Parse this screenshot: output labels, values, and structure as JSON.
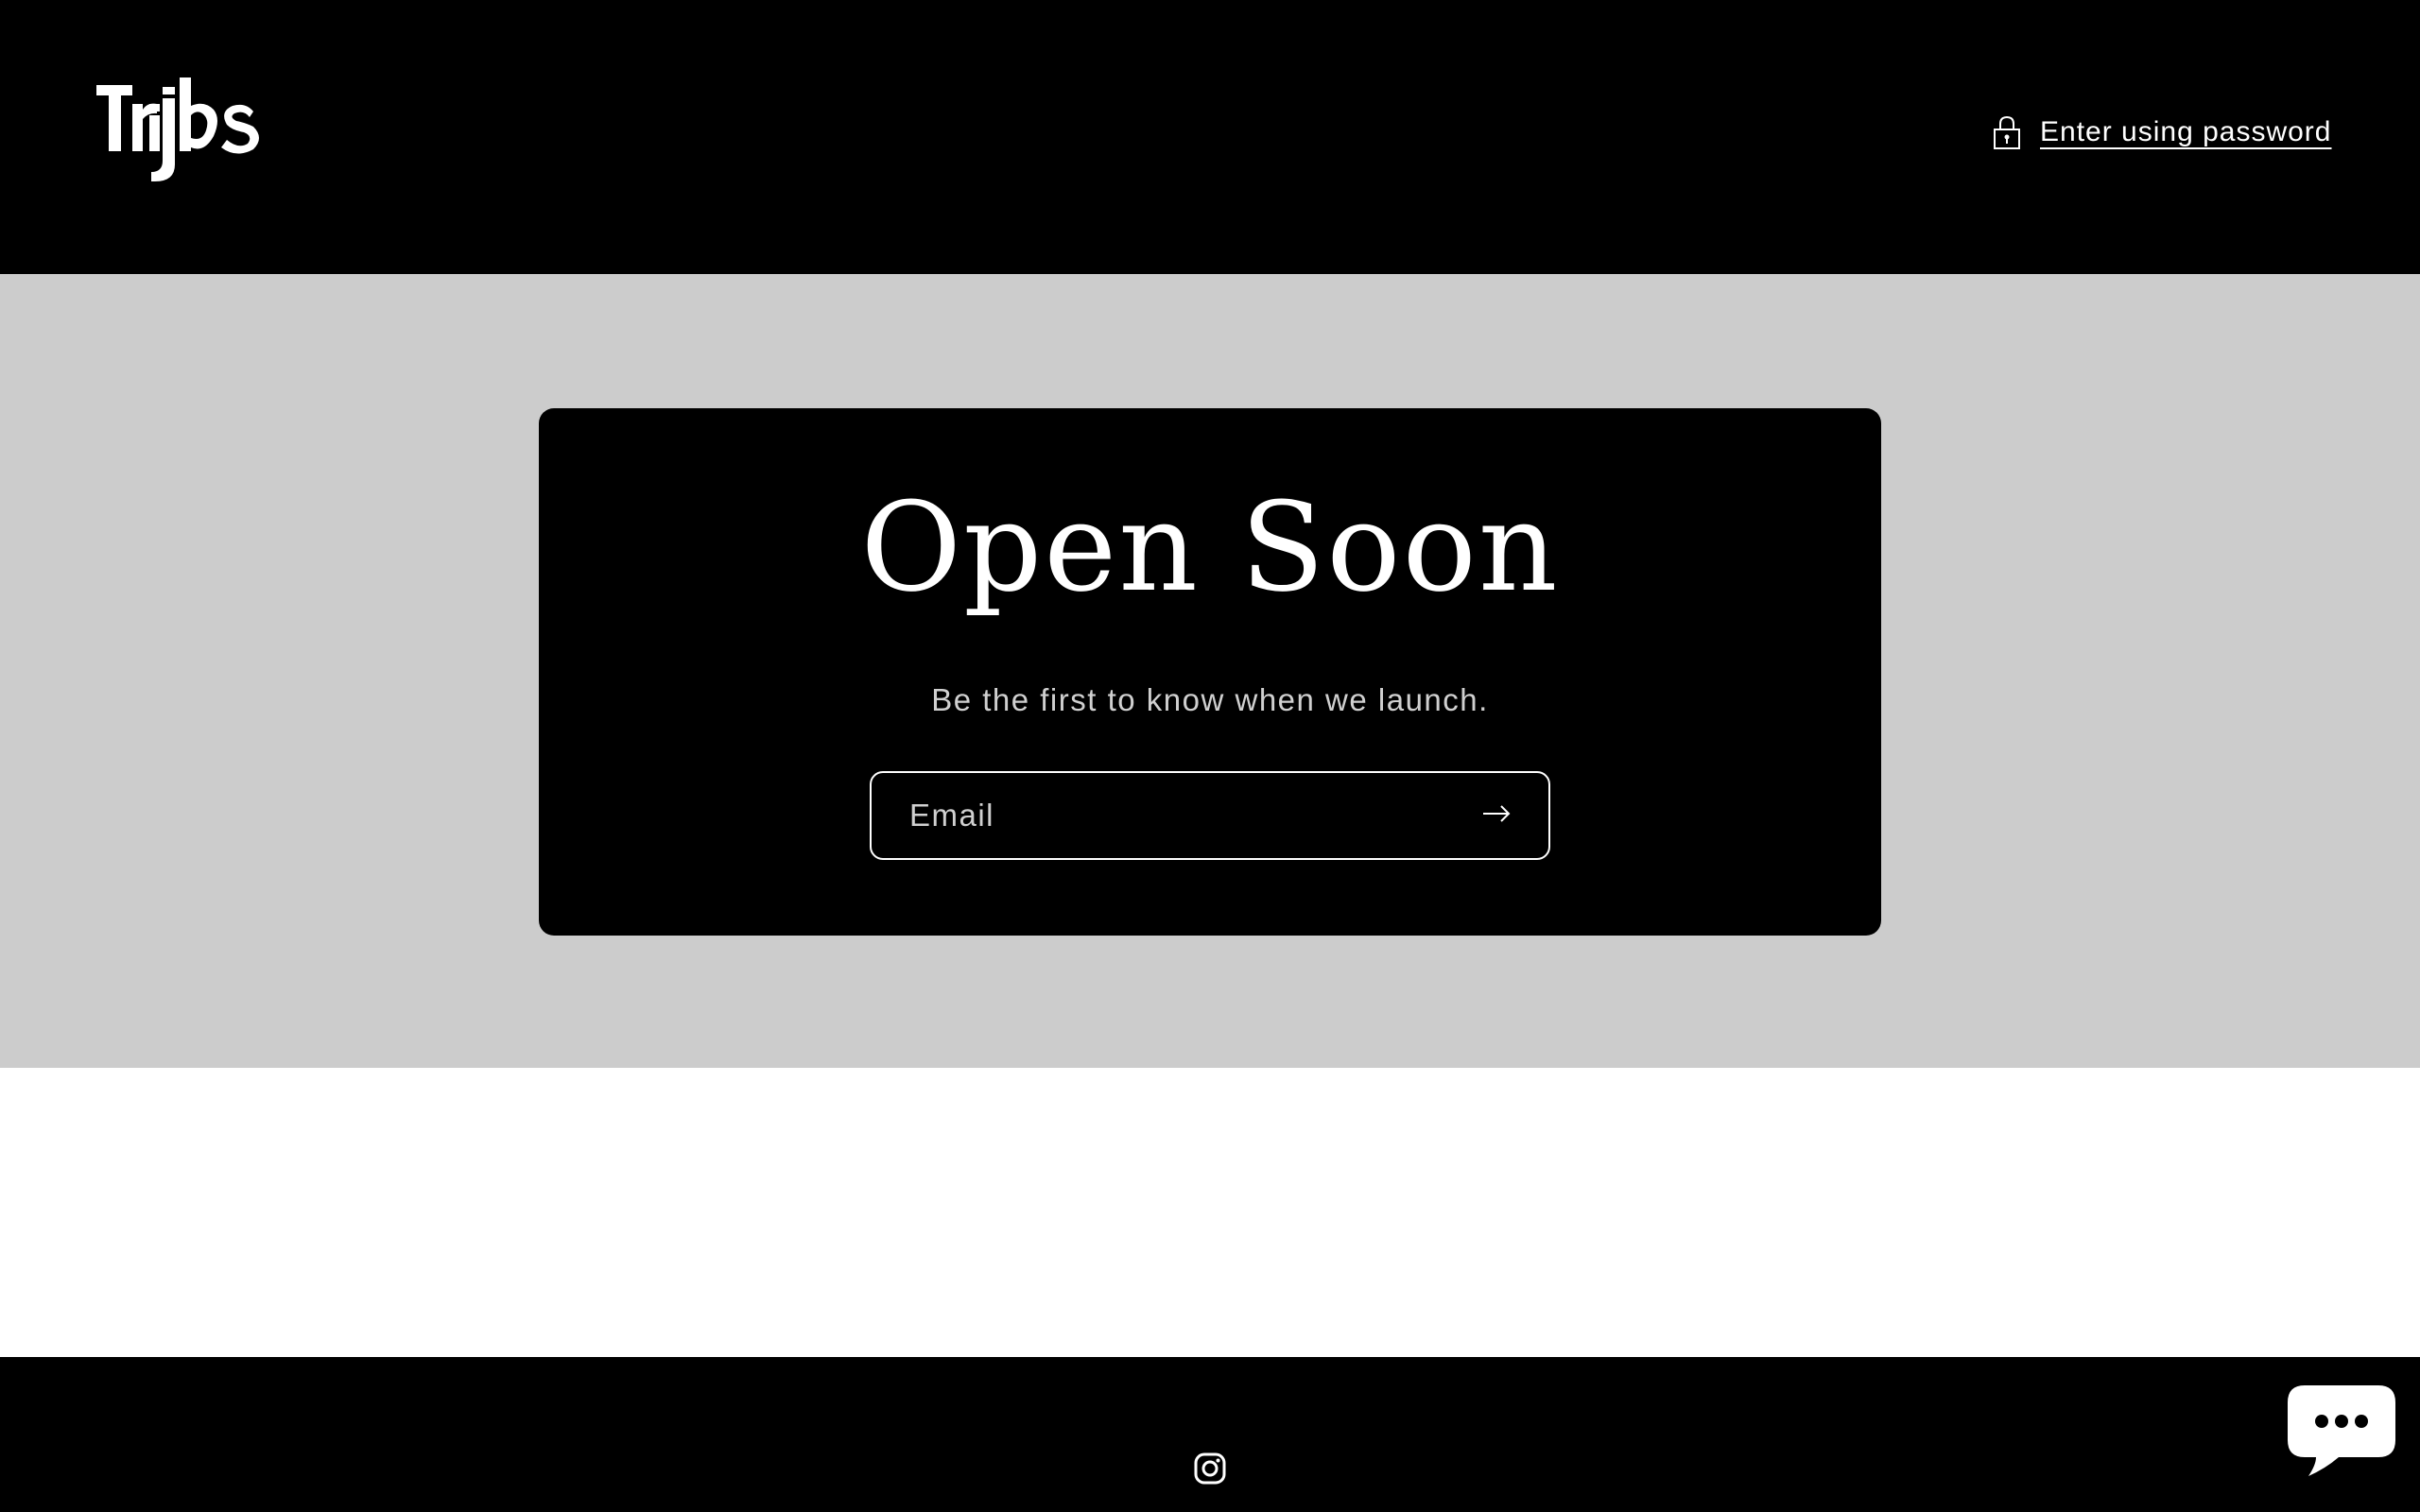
{
  "header": {
    "logo_text": "Trijbs",
    "password_link_label": "Enter using password"
  },
  "hero": {
    "title": "Open Soon",
    "subtitle": "Be the first to know when we launch.",
    "email_placeholder": "Email"
  },
  "footer": {
    "social_icon": "instagram-icon"
  },
  "chat": {
    "icon": "chat-bubble-icon"
  },
  "colors": {
    "header_bg": "#000000",
    "hero_bg": "#cccccc",
    "card_bg": "#000000",
    "text": "#ffffff",
    "muted_text": "#d0d0d0"
  }
}
